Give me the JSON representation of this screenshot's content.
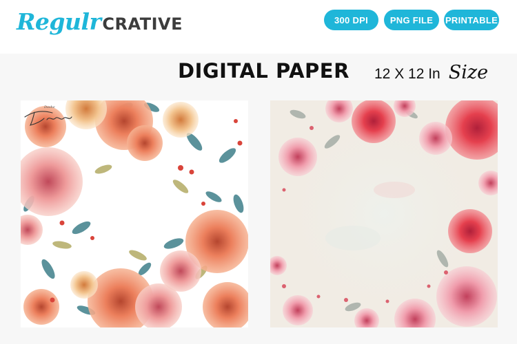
{
  "brand": {
    "script_part": "Regulr",
    "bold_part": "CRATIVE",
    "script_color": "#1fb6d9",
    "bold_color": "#3c3c3c"
  },
  "badges": [
    {
      "label": "300 DPI"
    },
    {
      "label": "PNG FILE"
    },
    {
      "label": "PRINTABLE"
    }
  ],
  "accent_color": "#1fb6d9",
  "title": "DIGITAL PAPER",
  "size": {
    "dimensions": "12 X 12 In",
    "word": "Size"
  },
  "previews": [
    {
      "name": "watercolor peach and coral peonies frame with teal leaves",
      "signature": "Dashe"
    },
    {
      "name": "pink watercolor floral border on cream paper"
    }
  ]
}
